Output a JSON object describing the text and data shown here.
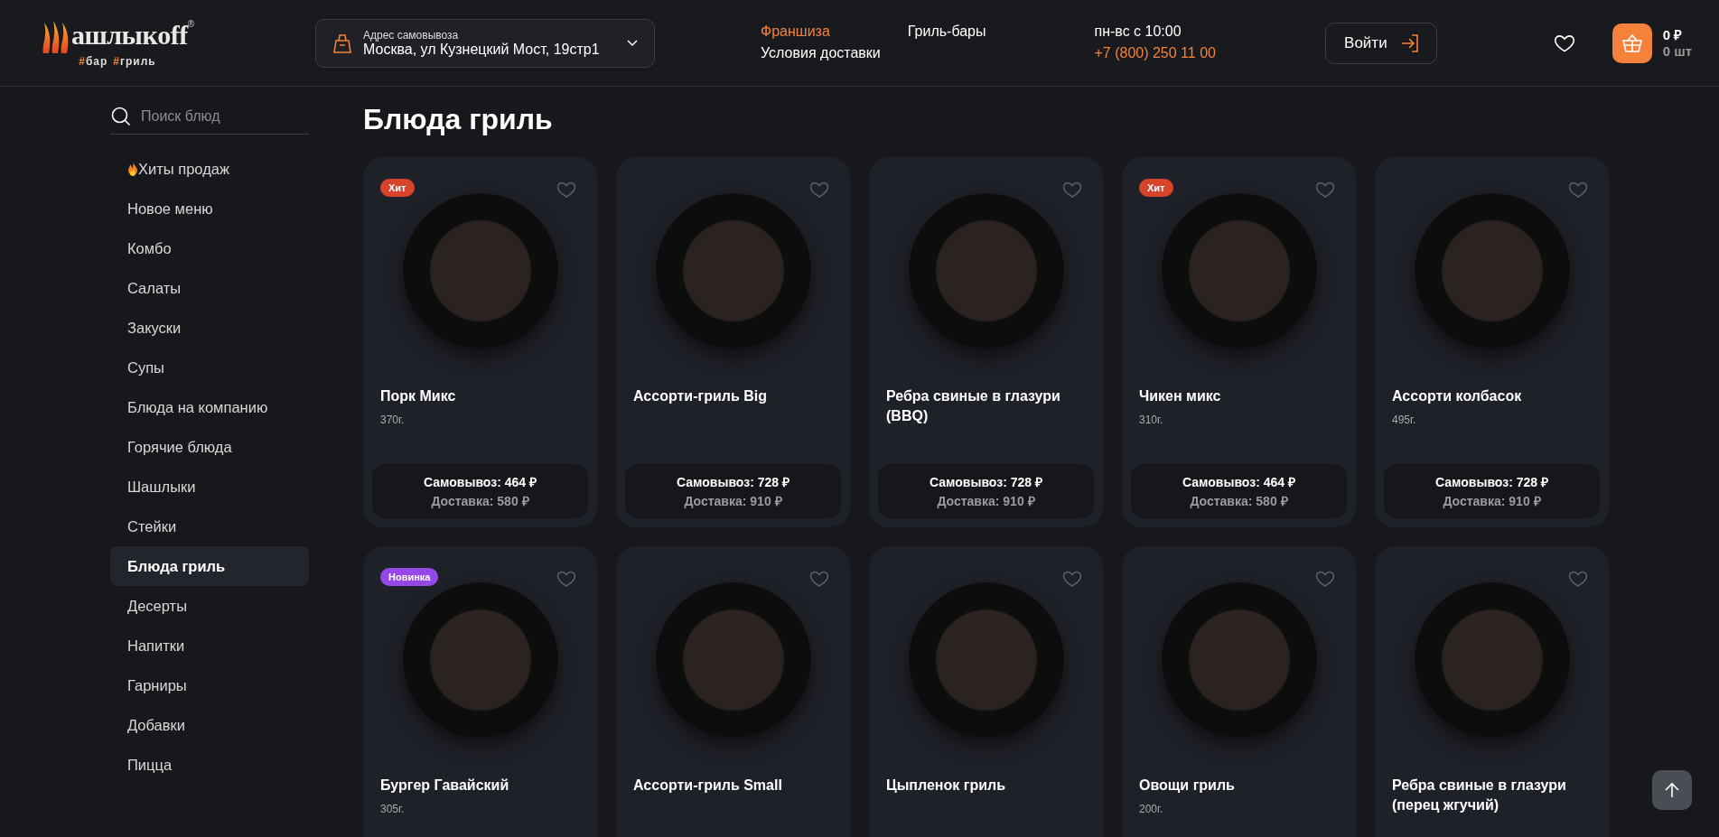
{
  "header": {
    "logo": {
      "brand": "ашлыкoff",
      "registered": "®",
      "tags": [
        "#бар",
        "#гриль"
      ]
    },
    "address": {
      "label": "Адрес самовывоза",
      "value": "Москва, ул Кузнецкий Мост, 19стр1"
    },
    "nav": [
      {
        "label": "Франшиза",
        "accent": true
      },
      {
        "label": "Условия доставки",
        "accent": false
      },
      {
        "label": "Гриль-бары",
        "accent": false
      }
    ],
    "hours": "пн-вс с 10:00",
    "phone": "+7 (800) 250 11 00",
    "login": "Войти",
    "cart": {
      "sum": "0 ₽",
      "count": "0 шт"
    }
  },
  "sidebar": {
    "search": {
      "placeholder": "Поиск блюд"
    },
    "items": [
      {
        "label": "Хиты продаж",
        "kind": "hot",
        "selected": false
      },
      {
        "label": "Новое меню",
        "kind": "plain",
        "selected": false
      },
      {
        "label": "Комбо",
        "kind": "plain",
        "selected": false
      },
      {
        "label": "Салаты",
        "kind": "plain",
        "selected": false
      },
      {
        "label": "Закуски",
        "kind": "plain",
        "selected": false
      },
      {
        "label": "Супы",
        "kind": "plain",
        "selected": false
      },
      {
        "label": "Блюда на компанию",
        "kind": "plain",
        "selected": false
      },
      {
        "label": "Горячие блюда",
        "kind": "plain",
        "selected": false
      },
      {
        "label": "Шашлыки",
        "kind": "plain",
        "selected": false
      },
      {
        "label": "Стейки",
        "kind": "plain",
        "selected": false
      },
      {
        "label": "Блюда гриль",
        "kind": "plain",
        "selected": true
      },
      {
        "label": "Десерты",
        "kind": "plain",
        "selected": false
      },
      {
        "label": "Напитки",
        "kind": "plain",
        "selected": false
      },
      {
        "label": "Гарниры",
        "kind": "plain",
        "selected": false
      },
      {
        "label": "Добавки",
        "kind": "plain",
        "selected": false
      },
      {
        "label": "Пицца",
        "kind": "plain",
        "selected": false
      }
    ]
  },
  "title": "Блюда гриль",
  "products": [
    {
      "badge": {
        "label": "Хит",
        "color": "#d8432c"
      },
      "name": "Порк Микс",
      "weight": "370г.",
      "pickup": "Самовывоз: 464 ₽",
      "delivery": "Доставка: 580 ₽"
    },
    {
      "name": "Ассорти-гриль Big",
      "pickup": "Самовывоз: 728 ₽",
      "delivery": "Доставка: 910 ₽"
    },
    {
      "name": "Ребра свиные в глазури (BBQ)",
      "pickup": "Самовывоз: 728 ₽",
      "delivery": "Доставка: 910 ₽"
    },
    {
      "badge": {
        "label": "Хит",
        "color": "#d8432c"
      },
      "name": "Чикен микс",
      "weight": "310г.",
      "pickup": "Самовывоз: 464 ₽",
      "delivery": "Доставка: 580 ₽"
    },
    {
      "name": "Ассорти колбасок",
      "weight": "495г.",
      "pickup": "Самовывоз: 728 ₽",
      "delivery": "Доставка: 910 ₽"
    },
    {
      "badge": {
        "label": "Новинка",
        "color": "#9747e8"
      },
      "name": "Бургер Гавайский",
      "weight": "305г."
    },
    {
      "name": "Ассорти-гриль Small"
    },
    {
      "name": "Цыпленок гриль"
    },
    {
      "name": "Овощи гриль",
      "weight": "200г."
    },
    {
      "name": "Ребра свиные в глазури (перец жгучий)"
    }
  ]
}
